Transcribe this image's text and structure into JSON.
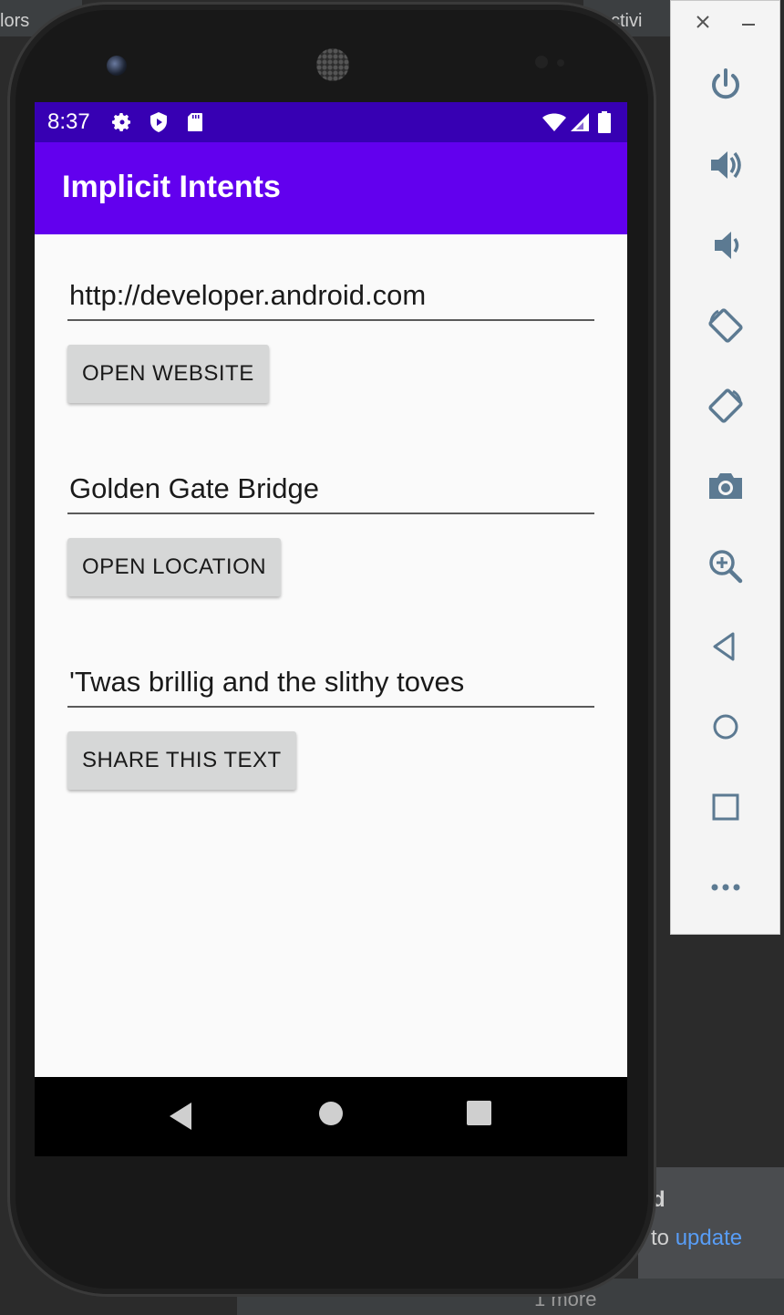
{
  "ide": {
    "top_left_fragment": "lors",
    "top_right_fragment": "ctivi",
    "notification_title_fragment": "d",
    "notification_text_prefix": "to",
    "notification_link": "update",
    "more_link": "1 more"
  },
  "status_bar": {
    "time": "8:37"
  },
  "app": {
    "title": "Implicit Intents"
  },
  "form": {
    "website_value": "http://developer.android.com",
    "website_button": "OPEN WEBSITE",
    "location_value": "Golden Gate Bridge",
    "location_button": "OPEN LOCATION",
    "share_value": "'Twas brillig and the slithy toves",
    "share_button": "SHARE THIS TEXT"
  },
  "colors": {
    "status_bar": "#3700b3",
    "app_bar": "#6200ee",
    "button_bg": "#d6d7d7",
    "screen_bg": "#fafafa"
  },
  "side_panel": {
    "icons": [
      "close-icon",
      "minimize-icon",
      "power-icon",
      "volume-up-icon",
      "volume-down-icon",
      "rotate-left-icon",
      "rotate-right-icon",
      "camera-icon",
      "zoom-icon",
      "back-icon",
      "home-icon",
      "overview-icon",
      "more-icon"
    ]
  }
}
